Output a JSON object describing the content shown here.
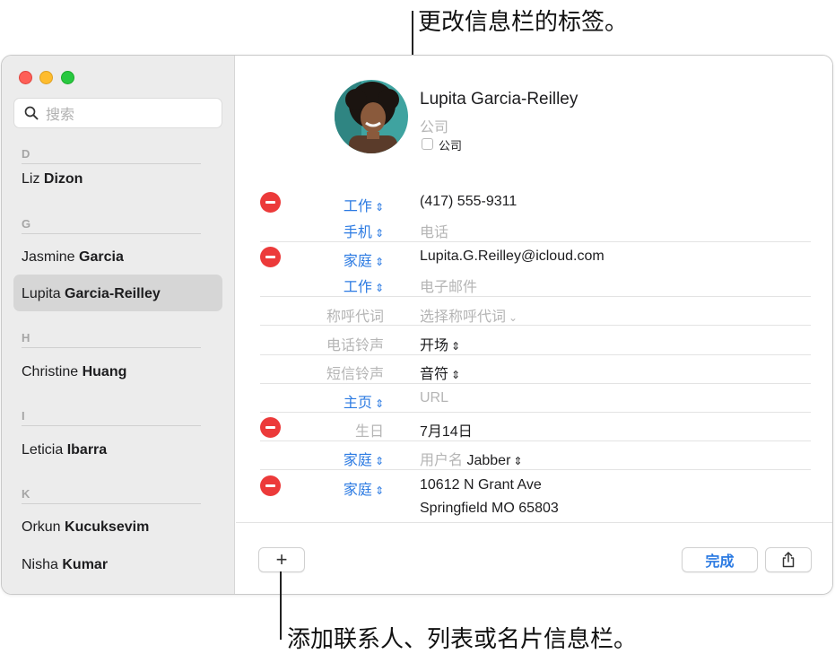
{
  "callouts": {
    "top": "更改信息栏的标签。",
    "bottom": "添加联系人、列表或名片信息栏。"
  },
  "sidebar": {
    "search_placeholder": "搜索",
    "sections": [
      {
        "letter": "D",
        "contacts": [
          {
            "first": "Liz",
            "last": "Dizon"
          }
        ]
      },
      {
        "letter": "G",
        "contacts": [
          {
            "first": "Jasmine",
            "last": "Garcia"
          },
          {
            "first": "Lupita",
            "last": "Garcia-Reilley",
            "selected": true
          }
        ]
      },
      {
        "letter": "H",
        "contacts": [
          {
            "first": "Christine",
            "last": "Huang"
          }
        ]
      },
      {
        "letter": "I",
        "contacts": [
          {
            "first": "Leticia",
            "last": "Ibarra"
          }
        ]
      },
      {
        "letter": "K",
        "contacts": [
          {
            "first": "Orkun",
            "last": "Kucuksevim"
          },
          {
            "first": "Nisha",
            "last": "Kumar"
          }
        ]
      }
    ]
  },
  "card": {
    "name": "Lupita  Garcia-Reilley",
    "company_placeholder": "公司",
    "company_checkbox_label": "公司",
    "rows": [
      {
        "label": "工作",
        "value": "(417) 555-9311"
      },
      {
        "label": "手机",
        "value": "电话"
      },
      {
        "label": "家庭",
        "value": "Lupita.G.Reilley@icloud.com"
      },
      {
        "label": "工作",
        "value": "电子邮件"
      },
      {
        "label": "称呼代词",
        "value": "选择称呼代词"
      },
      {
        "label": "电话铃声",
        "value": "开场"
      },
      {
        "label": "短信铃声",
        "value": "音符"
      },
      {
        "label": "主页",
        "value": "URL"
      },
      {
        "label": "生日",
        "value": "7月14日"
      },
      {
        "label": "家庭",
        "value_prefix": "用户名",
        "value": "Jabber"
      },
      {
        "label": "家庭",
        "value": "10612 N Grant Ave",
        "value_line2": "Springfield MO 65803"
      }
    ]
  },
  "footer": {
    "add_label": "+",
    "done_label": "完成"
  },
  "icons": {
    "search": "search-icon",
    "share": "share-icon",
    "remove": "minus-circle-icon",
    "chevron": "up-down-chevron-icon"
  },
  "colors": {
    "accent": "#2b7ae2",
    "remove": "#ec3a3a",
    "sidebar_bg": "#ececec",
    "selected_bg": "#d6d6d6"
  }
}
